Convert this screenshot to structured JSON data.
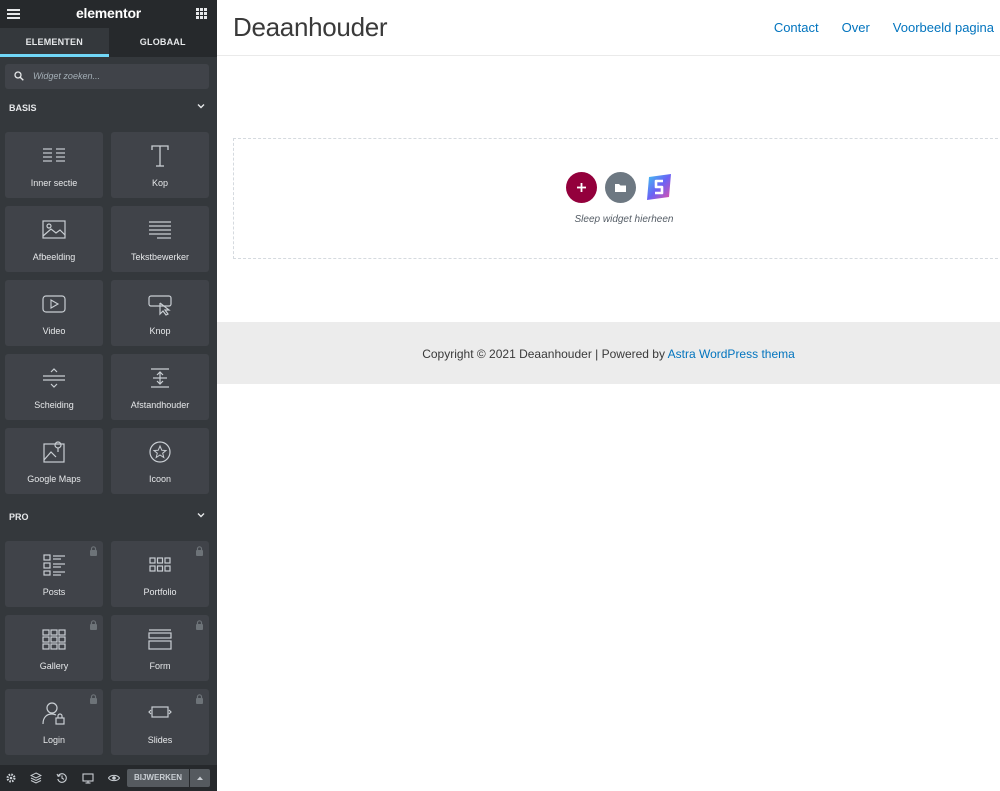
{
  "editor": {
    "logo": "elementor",
    "tabs": [
      "ELEMENTEN",
      "GLOBAAL"
    ],
    "search_placeholder": "Widget zoeken...",
    "categories": [
      {
        "name": "BASIS",
        "widgets": [
          {
            "label": "Inner sectie",
            "icon": "inner-section-icon",
            "locked": false
          },
          {
            "label": "Kop",
            "icon": "heading-icon",
            "locked": false
          },
          {
            "label": "Afbeelding",
            "icon": "image-icon",
            "locked": false
          },
          {
            "label": "Tekstbewerker",
            "icon": "text-editor-icon",
            "locked": false
          },
          {
            "label": "Video",
            "icon": "video-icon",
            "locked": false
          },
          {
            "label": "Knop",
            "icon": "button-icon",
            "locked": false
          },
          {
            "label": "Scheiding",
            "icon": "divider-icon",
            "locked": false
          },
          {
            "label": "Afstandhouder",
            "icon": "spacer-icon",
            "locked": false
          },
          {
            "label": "Google Maps",
            "icon": "google-maps-icon",
            "locked": false
          },
          {
            "label": "Icoon",
            "icon": "star-icon",
            "locked": false
          }
        ]
      },
      {
        "name": "PRO",
        "widgets": [
          {
            "label": "Posts",
            "icon": "posts-icon",
            "locked": true
          },
          {
            "label": "Portfolio",
            "icon": "portfolio-icon",
            "locked": true
          },
          {
            "label": "Gallery",
            "icon": "gallery-icon",
            "locked": true
          },
          {
            "label": "Form",
            "icon": "form-icon",
            "locked": true
          },
          {
            "label": "Login",
            "icon": "login-icon",
            "locked": true
          },
          {
            "label": "Slides",
            "icon": "slides-icon",
            "locked": true
          }
        ]
      }
    ],
    "footer": {
      "update_label": "BIJWERKEN",
      "icons": [
        "settings-icon",
        "navigator-icon",
        "history-icon",
        "responsive-icon",
        "preview-icon"
      ]
    }
  },
  "site": {
    "title": "Deaanhouder",
    "nav": [
      "Contact",
      "Over",
      "Voorbeeld pagina"
    ],
    "drop_label": "Sleep widget hierheen",
    "footer_prefix": "Copyright © 2021 Deaanhouder | Powered by ",
    "footer_link": "Astra WordPress thema"
  },
  "colors": {
    "accent_tab": "#71d7f7",
    "add_button": "#93003c",
    "template_button": "#6d7882",
    "link": "#0274be"
  }
}
